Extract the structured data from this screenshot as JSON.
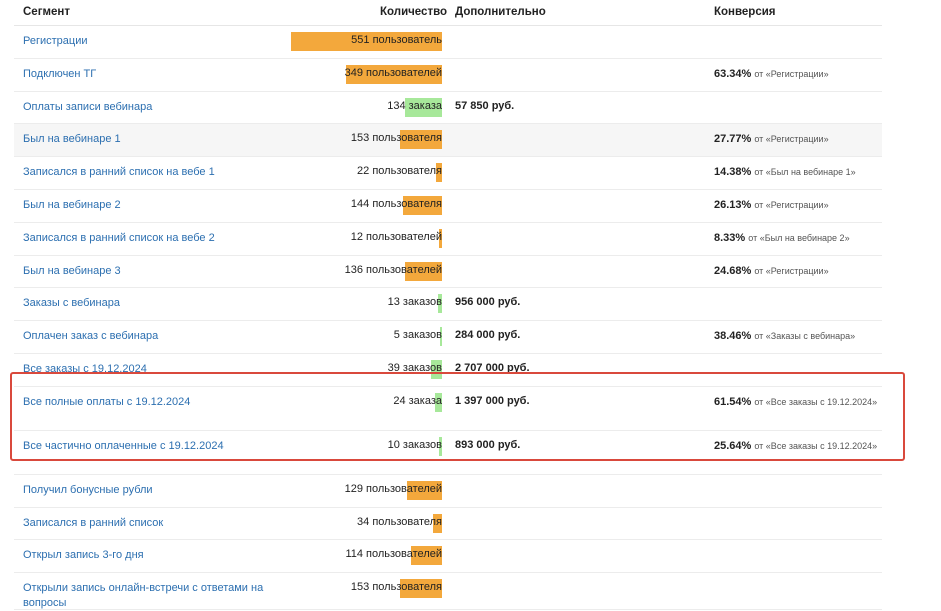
{
  "header": {
    "segment": "Сегмент",
    "quantity": "Количество",
    "additional": "Дополнительно",
    "conversion": "Конверсия"
  },
  "rows": [
    {
      "segment": "Регистрации",
      "quantity": "551 пользователь",
      "bar_value": 551,
      "bar_color": "orange",
      "additional": "",
      "conv_pct": "",
      "conv_ref": ""
    },
    {
      "segment": "Подключен ТГ",
      "quantity": "349 пользователей",
      "bar_value": 349,
      "bar_color": "orange",
      "additional": "",
      "conv_pct": "63.34%",
      "conv_ref": "от «Регистрации»"
    },
    {
      "segment": "Оплаты записи вебинара",
      "quantity": "134 заказа",
      "bar_value": 134,
      "bar_color": "green",
      "additional": "57 850 руб.",
      "conv_pct": "",
      "conv_ref": ""
    },
    {
      "segment": "Был на вебинаре 1",
      "quantity": "153 пользователя",
      "bar_value": 153,
      "bar_color": "orange",
      "additional": "",
      "conv_pct": "27.77%",
      "conv_ref": "от «Регистрации»"
    },
    {
      "segment": "Записался в ранний список на вебе 1",
      "quantity": "22 пользователя",
      "bar_value": 22,
      "bar_color": "orange",
      "additional": "",
      "conv_pct": "14.38%",
      "conv_ref": "от «Был на вебинаре 1»"
    },
    {
      "segment": "Был на вебинаре 2",
      "quantity": "144 пользователя",
      "bar_value": 144,
      "bar_color": "orange",
      "additional": "",
      "conv_pct": "26.13%",
      "conv_ref": "от «Регистрации»"
    },
    {
      "segment": "Записался в ранний список на вебе 2",
      "quantity": "12 пользователей",
      "bar_value": 12,
      "bar_color": "orange",
      "additional": "",
      "conv_pct": "8.33%",
      "conv_ref": "от «Был на вебинаре 2»"
    },
    {
      "segment": "Был на вебинаре 3",
      "quantity": "136 пользователей",
      "bar_value": 136,
      "bar_color": "orange",
      "additional": "",
      "conv_pct": "24.68%",
      "conv_ref": "от «Регистрации»"
    },
    {
      "segment": "Заказы с вебинара",
      "quantity": "13 заказов",
      "bar_value": 13,
      "bar_color": "green",
      "additional": "956 000 руб.",
      "conv_pct": "",
      "conv_ref": ""
    },
    {
      "segment": "Оплачен заказ с вебинара",
      "quantity": "5 заказов",
      "bar_value": 5,
      "bar_color": "green",
      "additional": "284 000 руб.",
      "conv_pct": "38.46%",
      "conv_ref": "от «Заказы с вебинара»"
    },
    {
      "segment": "Все заказы с 19.12.2024",
      "quantity": "39 заказов",
      "bar_value": 39,
      "bar_color": "green",
      "additional": "2 707 000 руб.",
      "conv_pct": "",
      "conv_ref": ""
    },
    {
      "segment": "Все полные оплаты с 19.12.2024",
      "quantity": "24 заказа",
      "bar_value": 24,
      "bar_color": "green",
      "additional": "1 397 000 руб.",
      "conv_pct": "61.54%",
      "conv_ref": "от «Все заказы с 19.12.2024»"
    },
    {
      "segment": "Все частично оплаченные с 19.12.2024",
      "quantity": "10 заказов",
      "bar_value": 10,
      "bar_color": "green",
      "additional": "893 000 руб.",
      "conv_pct": "25.64%",
      "conv_ref": "от «Все заказы с 19.12.2024»"
    },
    {
      "segment": "Получил бонусные рубли",
      "quantity": "129 пользователей",
      "bar_value": 129,
      "bar_color": "orange",
      "additional": "",
      "conv_pct": "",
      "conv_ref": ""
    },
    {
      "segment": "Записался в ранний список",
      "quantity": "34 пользователя",
      "bar_value": 34,
      "bar_color": "orange",
      "additional": "",
      "conv_pct": "",
      "conv_ref": ""
    },
    {
      "segment": "Открыл запись 3-го дня",
      "quantity": "114 пользователей",
      "bar_value": 114,
      "bar_color": "orange",
      "additional": "",
      "conv_pct": "",
      "conv_ref": ""
    },
    {
      "segment": "Открыли запись онлайн-встречи с ответами на вопросы",
      "quantity": "153 пользователя",
      "bar_value": 153,
      "bar_color": "orange",
      "additional": "",
      "conv_pct": "",
      "conv_ref": ""
    }
  ],
  "colors": {
    "orange": "#f3a83c",
    "green": "#a7e89a",
    "link": "#2c6fb0",
    "highlight": "#d9493c"
  }
}
